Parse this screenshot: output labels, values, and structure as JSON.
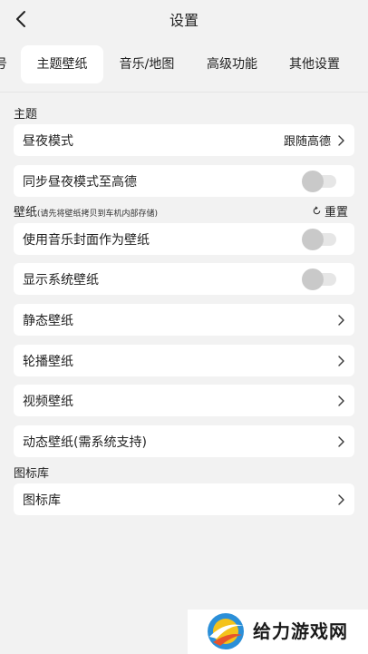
{
  "header": {
    "title": "设置",
    "back_icon": "chevron-left-icon"
  },
  "tabs": [
    {
      "label": "号",
      "active": false
    },
    {
      "label": "主题壁纸",
      "active": true
    },
    {
      "label": "音乐/地图",
      "active": false
    },
    {
      "label": "高级功能",
      "active": false
    },
    {
      "label": "其他设置",
      "active": false
    }
  ],
  "sections": {
    "theme": {
      "label": "主题"
    },
    "wallpaper": {
      "label": "壁纸",
      "hint": "(请先将壁纸拷贝到车机内部存储)",
      "reset_label": "重置"
    },
    "icons": {
      "label": "图标库"
    }
  },
  "rows": {
    "day_night_mode": {
      "label": "昼夜模式",
      "value": "跟随高德"
    },
    "sync_day_night": {
      "label": "同步昼夜模式至高德",
      "toggle_on": false
    },
    "music_cover_wallpaper": {
      "label": "使用音乐封面作为壁纸",
      "toggle_on": false
    },
    "show_system_wallpaper": {
      "label": "显示系统壁纸",
      "toggle_on": false
    },
    "static_wallpaper": {
      "label": "静态壁纸"
    },
    "carousel_wallpaper": {
      "label": "轮播壁纸"
    },
    "video_wallpaper": {
      "label": "视频壁纸"
    },
    "dynamic_wallpaper": {
      "label": "动态壁纸(需系统支持)"
    },
    "icon_library": {
      "label": "图标库"
    }
  },
  "watermark": {
    "text": "给力游戏网"
  },
  "colors": {
    "background": "#f2f2f2",
    "card": "#ffffff",
    "toggle_track": "#e6e6e6",
    "toggle_knob": "#c9c9c9"
  }
}
